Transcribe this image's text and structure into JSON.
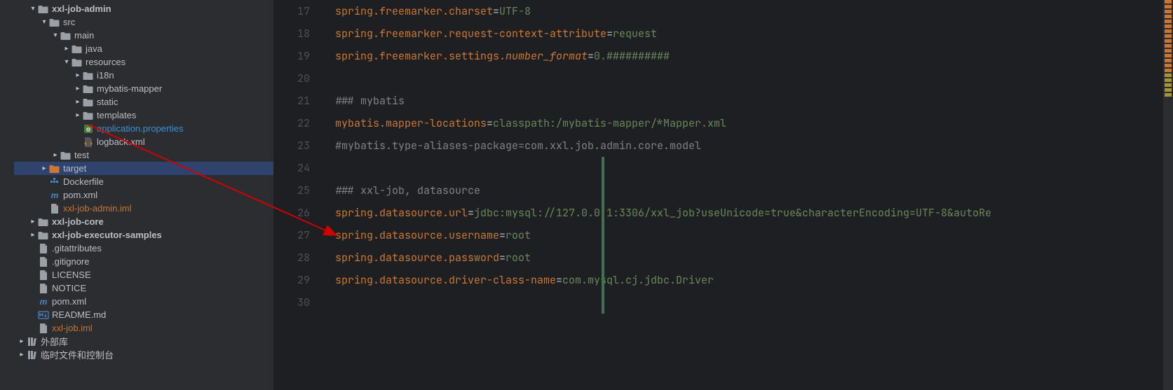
{
  "tree": [
    {
      "indent": 1,
      "chevron": "down",
      "icon": "folder-open",
      "label": "xxl-job-admin",
      "bold": true,
      "highlighted": false
    },
    {
      "indent": 2,
      "chevron": "down",
      "icon": "folder-open",
      "label": "src",
      "bold": false
    },
    {
      "indent": 3,
      "chevron": "down",
      "icon": "folder-open",
      "label": "main",
      "bold": false
    },
    {
      "indent": 4,
      "chevron": "right",
      "icon": "folder",
      "label": "java",
      "bold": false
    },
    {
      "indent": 4,
      "chevron": "down",
      "icon": "folder-open",
      "label": "resources",
      "bold": false
    },
    {
      "indent": 5,
      "chevron": "right",
      "icon": "folder",
      "label": "i18n",
      "bold": false
    },
    {
      "indent": 5,
      "chevron": "right",
      "icon": "folder",
      "label": "mybatis-mapper",
      "bold": false
    },
    {
      "indent": 5,
      "chevron": "right",
      "icon": "folder",
      "label": "static",
      "bold": false
    },
    {
      "indent": 5,
      "chevron": "right",
      "icon": "folder",
      "label": "templates",
      "bold": false
    },
    {
      "indent": 5,
      "chevron": "",
      "icon": "properties",
      "label": "application.properties",
      "highlighted": true
    },
    {
      "indent": 5,
      "chevron": "",
      "icon": "xml",
      "label": "logback.xml",
      "bold": false
    },
    {
      "indent": 3,
      "chevron": "right",
      "icon": "folder",
      "label": "test",
      "bold": false
    },
    {
      "indent": 2,
      "chevron": "right",
      "icon": "folder-orange",
      "label": "target",
      "selected": true
    },
    {
      "indent": 2,
      "chevron": "",
      "icon": "docker",
      "label": "Dockerfile"
    },
    {
      "indent": 2,
      "chevron": "",
      "icon": "maven",
      "label": "pom.xml"
    },
    {
      "indent": 2,
      "chevron": "",
      "icon": "file",
      "label": "xxl-job-admin.iml",
      "muted": true,
      "color": "#c57633"
    },
    {
      "indent": 1,
      "chevron": "right",
      "icon": "folder",
      "label": "xxl-job-core",
      "bold": true
    },
    {
      "indent": 1,
      "chevron": "right",
      "icon": "folder",
      "label": "xxl-job-executor-samples",
      "bold": true
    },
    {
      "indent": 1,
      "chevron": "",
      "icon": "file",
      "label": ".gitattributes"
    },
    {
      "indent": 1,
      "chevron": "",
      "icon": "file",
      "label": ".gitignore"
    },
    {
      "indent": 1,
      "chevron": "",
      "icon": "file",
      "label": "LICENSE"
    },
    {
      "indent": 1,
      "chevron": "",
      "icon": "file",
      "label": "NOTICE"
    },
    {
      "indent": 1,
      "chevron": "",
      "icon": "maven",
      "label": "pom.xml"
    },
    {
      "indent": 1,
      "chevron": "",
      "icon": "md",
      "label": "README.md"
    },
    {
      "indent": 1,
      "chevron": "",
      "icon": "file",
      "label": "xxl-job.iml",
      "color": "#c57633"
    },
    {
      "indent": 0,
      "chevron": "right",
      "icon": "library",
      "label": "外部库"
    },
    {
      "indent": 0,
      "chevron": "right",
      "icon": "library",
      "label": "临时文件和控制台"
    }
  ],
  "editor": {
    "startLine": 17,
    "lines": [
      {
        "n": 17,
        "segments": [
          {
            "t": "spring.freemarker.charset",
            "c": "key"
          },
          {
            "t": "=",
            "c": "eq"
          },
          {
            "t": "UTF-8",
            "c": "val"
          }
        ]
      },
      {
        "n": 18,
        "segments": [
          {
            "t": "spring.freemarker.request-context-attribute",
            "c": "key"
          },
          {
            "t": "=",
            "c": "eq"
          },
          {
            "t": "request",
            "c": "val"
          }
        ]
      },
      {
        "n": 19,
        "segments": [
          {
            "t": "spring.freemarker.settings.",
            "c": "key"
          },
          {
            "t": "number_format",
            "c": "key-italic"
          },
          {
            "t": "=",
            "c": "eq"
          },
          {
            "t": "0.##########",
            "c": "val"
          }
        ]
      },
      {
        "n": 20,
        "segments": []
      },
      {
        "n": 21,
        "segments": [
          {
            "t": "### mybatis",
            "c": "comment"
          }
        ]
      },
      {
        "n": 22,
        "segments": [
          {
            "t": "mybatis.mapper-locations",
            "c": "key"
          },
          {
            "t": "=",
            "c": "eq"
          },
          {
            "t": "classpath:/mybatis-mapper/*Mapper.xml",
            "c": "val"
          }
        ]
      },
      {
        "n": 23,
        "segments": [
          {
            "t": "#mybatis.type-aliases-package=com.xxl.job.admin.core.model",
            "c": "comment"
          }
        ]
      },
      {
        "n": 24,
        "segments": []
      },
      {
        "n": 25,
        "segments": [
          {
            "t": "### xxl-job, datasource",
            "c": "comment"
          }
        ]
      },
      {
        "n": 26,
        "segments": [
          {
            "t": "spring.datasource.url",
            "c": "key"
          },
          {
            "t": "=",
            "c": "eq"
          },
          {
            "t": "jdbc:mysql://127.0.0.1:3306/xxl_job?useUnicode=true&characterEncoding=UTF-8&autoRe",
            "c": "val"
          }
        ]
      },
      {
        "n": 27,
        "segments": [
          {
            "t": "spring.datasource.username",
            "c": "key"
          },
          {
            "t": "=",
            "c": "eq"
          },
          {
            "t": "root",
            "c": "val"
          }
        ]
      },
      {
        "n": 28,
        "segments": [
          {
            "t": "spring.datasource.password",
            "c": "key"
          },
          {
            "t": "=",
            "c": "eq"
          },
          {
            "t": "root",
            "c": "val"
          }
        ]
      },
      {
        "n": 29,
        "segments": [
          {
            "t": "spring.datasource.driver-class-name",
            "c": "key"
          },
          {
            "t": "=",
            "c": "eq"
          },
          {
            "t": "com.mysql.cj.jdbc.Driver",
            "c": "val"
          }
        ]
      },
      {
        "n": 30,
        "segments": []
      }
    ],
    "modifiedRange": {
      "from": 24,
      "to": 30
    }
  }
}
